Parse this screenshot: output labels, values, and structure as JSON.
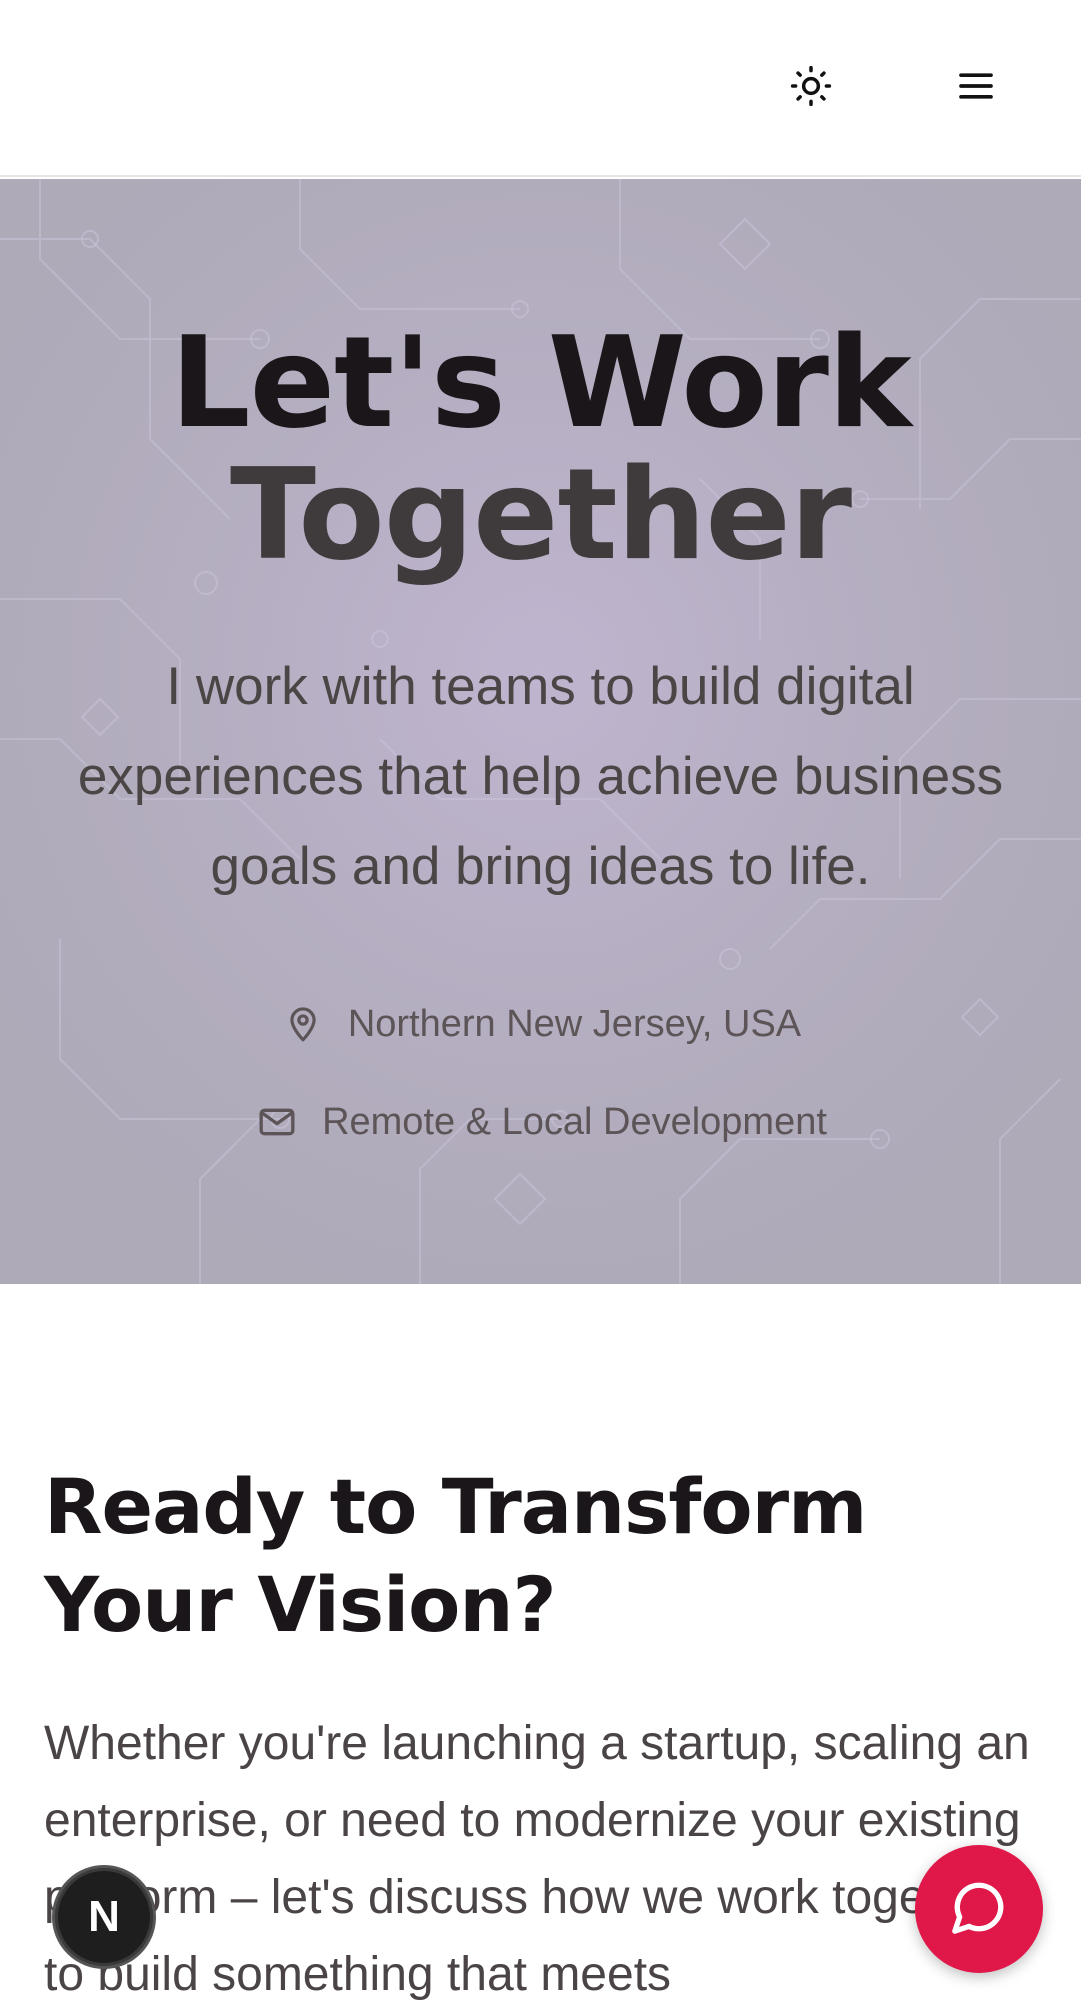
{
  "header": {
    "theme_toggle_icon": "sun-icon",
    "menu_icon": "hamburger-menu-icon"
  },
  "hero": {
    "title_line1": "Let's Work",
    "title_line2": "Together",
    "subtitle": "I work with teams to build digital experiences that help achieve business goals and bring ideas to life.",
    "location_icon": "map-pin-icon",
    "location": "Northern New Jersey, USA",
    "mail_icon": "mail-icon",
    "work_mode": "Remote & Local Development"
  },
  "section": {
    "title": "Ready to Transform Your Vision?",
    "body": "Whether you're launching a startup, scaling an enterprise, or need to modernize your existing platform – let's discuss how we work together to build something that meets"
  },
  "floating": {
    "left_badge_letter": "N",
    "chat_icon": "chat-bubble-icon"
  },
  "colors": {
    "hero_background": "#b3aebf",
    "chat_button": "#e0184a",
    "title_dark": "#1a1619"
  }
}
